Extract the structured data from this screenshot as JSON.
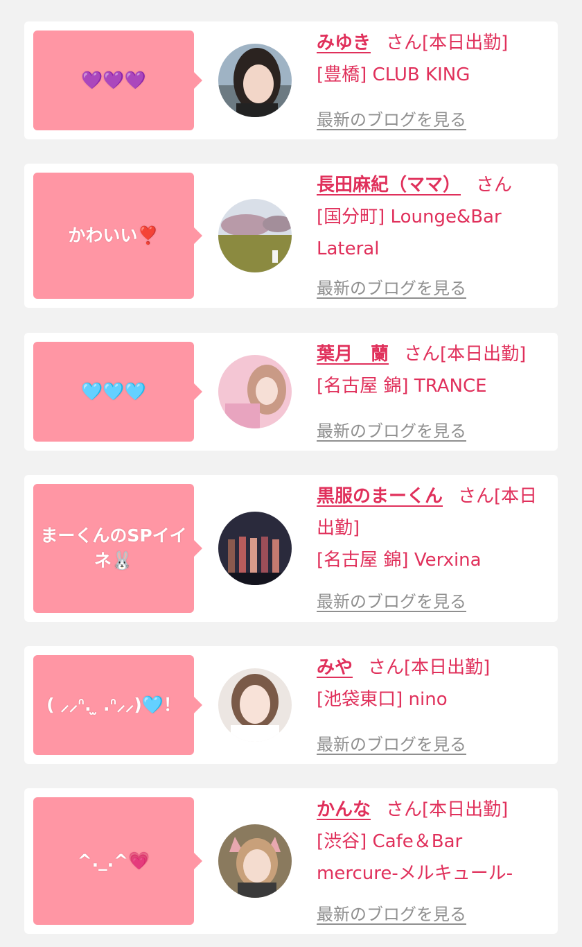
{
  "colors": {
    "page_background": "#f2f2f2",
    "card_background": "#ffffff",
    "bubble_pink": "#ff96a4",
    "name_pink": "#e0305b",
    "link_gray": "#8f8f8f"
  },
  "entries": [
    {
      "comment": "💜💜💜",
      "name": "みゆき",
      "san": "さん",
      "status": "[本日出勤]",
      "shop": "[豊橋] CLUB KING",
      "blog_link": "最新のブログを見る",
      "avatar_icon": "girl-portrait-photo"
    },
    {
      "comment": "かわいい❣️",
      "name": "長田麻紀（ママ）",
      "san": "さん",
      "status": "",
      "shop": "[国分町] Lounge&Bar Lateral",
      "blog_link": "最新のブログを見る",
      "avatar_icon": "cherry-blossom-park-photo"
    },
    {
      "comment": "🩵🩵🩵",
      "name": "葉月　蘭",
      "san": "さん",
      "status": "[本日出勤]",
      "shop": "[名古屋 錦] TRANCE",
      "blog_link": "最新のブログを見る",
      "avatar_icon": "pink-portrait-photo"
    },
    {
      "comment": "まーくんのSPイイネ🐰",
      "name": "黒服のまーくん",
      "san": "さん",
      "status": "[本日出勤]",
      "shop": "[名古屋 錦] Verxina",
      "blog_link": "最新のブログを見る",
      "avatar_icon": "group-photo"
    },
    {
      "comment": "( ⸝⸝ᐢ. ̫ .ᐢ⸝⸝)🩵！",
      "name": "みや",
      "san": "さん",
      "status": "[本日出勤]",
      "shop": "[池袋東口] nino",
      "blog_link": "最新のブログを見る",
      "avatar_icon": "girl-portrait-photo"
    },
    {
      "comment": "^._.^💗",
      "name": "かんな",
      "san": "さん",
      "status": "[本日出勤]",
      "shop": "[渋谷] Cafe＆Bar mercure-メルキュール-",
      "blog_link": "最新のブログを見る",
      "avatar_icon": "cat-ears-selfie-photo"
    }
  ]
}
